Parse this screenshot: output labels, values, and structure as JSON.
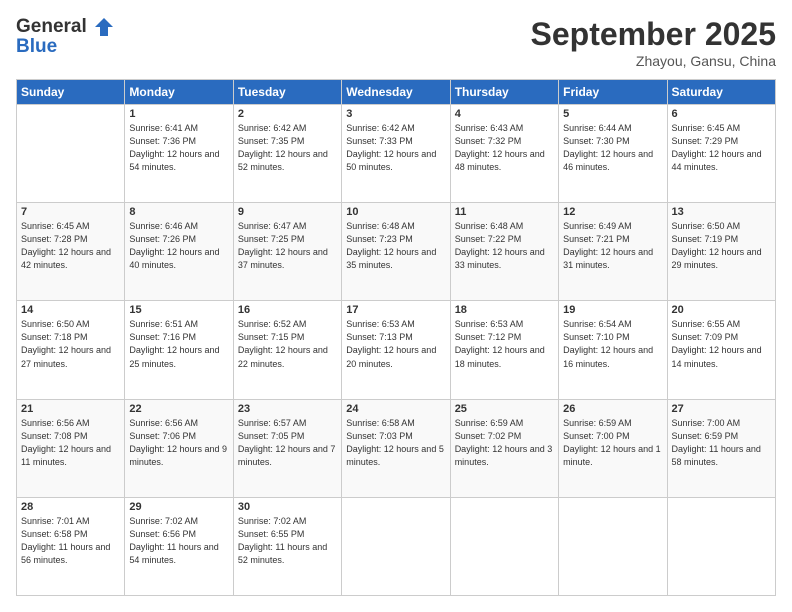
{
  "header": {
    "logo_line1": "General",
    "logo_line2": "Blue",
    "month_title": "September 2025",
    "location": "Zhayou, Gansu, China"
  },
  "weekdays": [
    "Sunday",
    "Monday",
    "Tuesday",
    "Wednesday",
    "Thursday",
    "Friday",
    "Saturday"
  ],
  "weeks": [
    [
      {
        "day": "",
        "sunrise": "",
        "sunset": "",
        "daylight": ""
      },
      {
        "day": "1",
        "sunrise": "Sunrise: 6:41 AM",
        "sunset": "Sunset: 7:36 PM",
        "daylight": "Daylight: 12 hours and 54 minutes."
      },
      {
        "day": "2",
        "sunrise": "Sunrise: 6:42 AM",
        "sunset": "Sunset: 7:35 PM",
        "daylight": "Daylight: 12 hours and 52 minutes."
      },
      {
        "day": "3",
        "sunrise": "Sunrise: 6:42 AM",
        "sunset": "Sunset: 7:33 PM",
        "daylight": "Daylight: 12 hours and 50 minutes."
      },
      {
        "day": "4",
        "sunrise": "Sunrise: 6:43 AM",
        "sunset": "Sunset: 7:32 PM",
        "daylight": "Daylight: 12 hours and 48 minutes."
      },
      {
        "day": "5",
        "sunrise": "Sunrise: 6:44 AM",
        "sunset": "Sunset: 7:30 PM",
        "daylight": "Daylight: 12 hours and 46 minutes."
      },
      {
        "day": "6",
        "sunrise": "Sunrise: 6:45 AM",
        "sunset": "Sunset: 7:29 PM",
        "daylight": "Daylight: 12 hours and 44 minutes."
      }
    ],
    [
      {
        "day": "7",
        "sunrise": "Sunrise: 6:45 AM",
        "sunset": "Sunset: 7:28 PM",
        "daylight": "Daylight: 12 hours and 42 minutes."
      },
      {
        "day": "8",
        "sunrise": "Sunrise: 6:46 AM",
        "sunset": "Sunset: 7:26 PM",
        "daylight": "Daylight: 12 hours and 40 minutes."
      },
      {
        "day": "9",
        "sunrise": "Sunrise: 6:47 AM",
        "sunset": "Sunset: 7:25 PM",
        "daylight": "Daylight: 12 hours and 37 minutes."
      },
      {
        "day": "10",
        "sunrise": "Sunrise: 6:48 AM",
        "sunset": "Sunset: 7:23 PM",
        "daylight": "Daylight: 12 hours and 35 minutes."
      },
      {
        "day": "11",
        "sunrise": "Sunrise: 6:48 AM",
        "sunset": "Sunset: 7:22 PM",
        "daylight": "Daylight: 12 hours and 33 minutes."
      },
      {
        "day": "12",
        "sunrise": "Sunrise: 6:49 AM",
        "sunset": "Sunset: 7:21 PM",
        "daylight": "Daylight: 12 hours and 31 minutes."
      },
      {
        "day": "13",
        "sunrise": "Sunrise: 6:50 AM",
        "sunset": "Sunset: 7:19 PM",
        "daylight": "Daylight: 12 hours and 29 minutes."
      }
    ],
    [
      {
        "day": "14",
        "sunrise": "Sunrise: 6:50 AM",
        "sunset": "Sunset: 7:18 PM",
        "daylight": "Daylight: 12 hours and 27 minutes."
      },
      {
        "day": "15",
        "sunrise": "Sunrise: 6:51 AM",
        "sunset": "Sunset: 7:16 PM",
        "daylight": "Daylight: 12 hours and 25 minutes."
      },
      {
        "day": "16",
        "sunrise": "Sunrise: 6:52 AM",
        "sunset": "Sunset: 7:15 PM",
        "daylight": "Daylight: 12 hours and 22 minutes."
      },
      {
        "day": "17",
        "sunrise": "Sunrise: 6:53 AM",
        "sunset": "Sunset: 7:13 PM",
        "daylight": "Daylight: 12 hours and 20 minutes."
      },
      {
        "day": "18",
        "sunrise": "Sunrise: 6:53 AM",
        "sunset": "Sunset: 7:12 PM",
        "daylight": "Daylight: 12 hours and 18 minutes."
      },
      {
        "day": "19",
        "sunrise": "Sunrise: 6:54 AM",
        "sunset": "Sunset: 7:10 PM",
        "daylight": "Daylight: 12 hours and 16 minutes."
      },
      {
        "day": "20",
        "sunrise": "Sunrise: 6:55 AM",
        "sunset": "Sunset: 7:09 PM",
        "daylight": "Daylight: 12 hours and 14 minutes."
      }
    ],
    [
      {
        "day": "21",
        "sunrise": "Sunrise: 6:56 AM",
        "sunset": "Sunset: 7:08 PM",
        "daylight": "Daylight: 12 hours and 11 minutes."
      },
      {
        "day": "22",
        "sunrise": "Sunrise: 6:56 AM",
        "sunset": "Sunset: 7:06 PM",
        "daylight": "Daylight: 12 hours and 9 minutes."
      },
      {
        "day": "23",
        "sunrise": "Sunrise: 6:57 AM",
        "sunset": "Sunset: 7:05 PM",
        "daylight": "Daylight: 12 hours and 7 minutes."
      },
      {
        "day": "24",
        "sunrise": "Sunrise: 6:58 AM",
        "sunset": "Sunset: 7:03 PM",
        "daylight": "Daylight: 12 hours and 5 minutes."
      },
      {
        "day": "25",
        "sunrise": "Sunrise: 6:59 AM",
        "sunset": "Sunset: 7:02 PM",
        "daylight": "Daylight: 12 hours and 3 minutes."
      },
      {
        "day": "26",
        "sunrise": "Sunrise: 6:59 AM",
        "sunset": "Sunset: 7:00 PM",
        "daylight": "Daylight: 12 hours and 1 minute."
      },
      {
        "day": "27",
        "sunrise": "Sunrise: 7:00 AM",
        "sunset": "Sunset: 6:59 PM",
        "daylight": "Daylight: 11 hours and 58 minutes."
      }
    ],
    [
      {
        "day": "28",
        "sunrise": "Sunrise: 7:01 AM",
        "sunset": "Sunset: 6:58 PM",
        "daylight": "Daylight: 11 hours and 56 minutes."
      },
      {
        "day": "29",
        "sunrise": "Sunrise: 7:02 AM",
        "sunset": "Sunset: 6:56 PM",
        "daylight": "Daylight: 11 hours and 54 minutes."
      },
      {
        "day": "30",
        "sunrise": "Sunrise: 7:02 AM",
        "sunset": "Sunset: 6:55 PM",
        "daylight": "Daylight: 11 hours and 52 minutes."
      },
      {
        "day": "",
        "sunrise": "",
        "sunset": "",
        "daylight": ""
      },
      {
        "day": "",
        "sunrise": "",
        "sunset": "",
        "daylight": ""
      },
      {
        "day": "",
        "sunrise": "",
        "sunset": "",
        "daylight": ""
      },
      {
        "day": "",
        "sunrise": "",
        "sunset": "",
        "daylight": ""
      }
    ]
  ]
}
